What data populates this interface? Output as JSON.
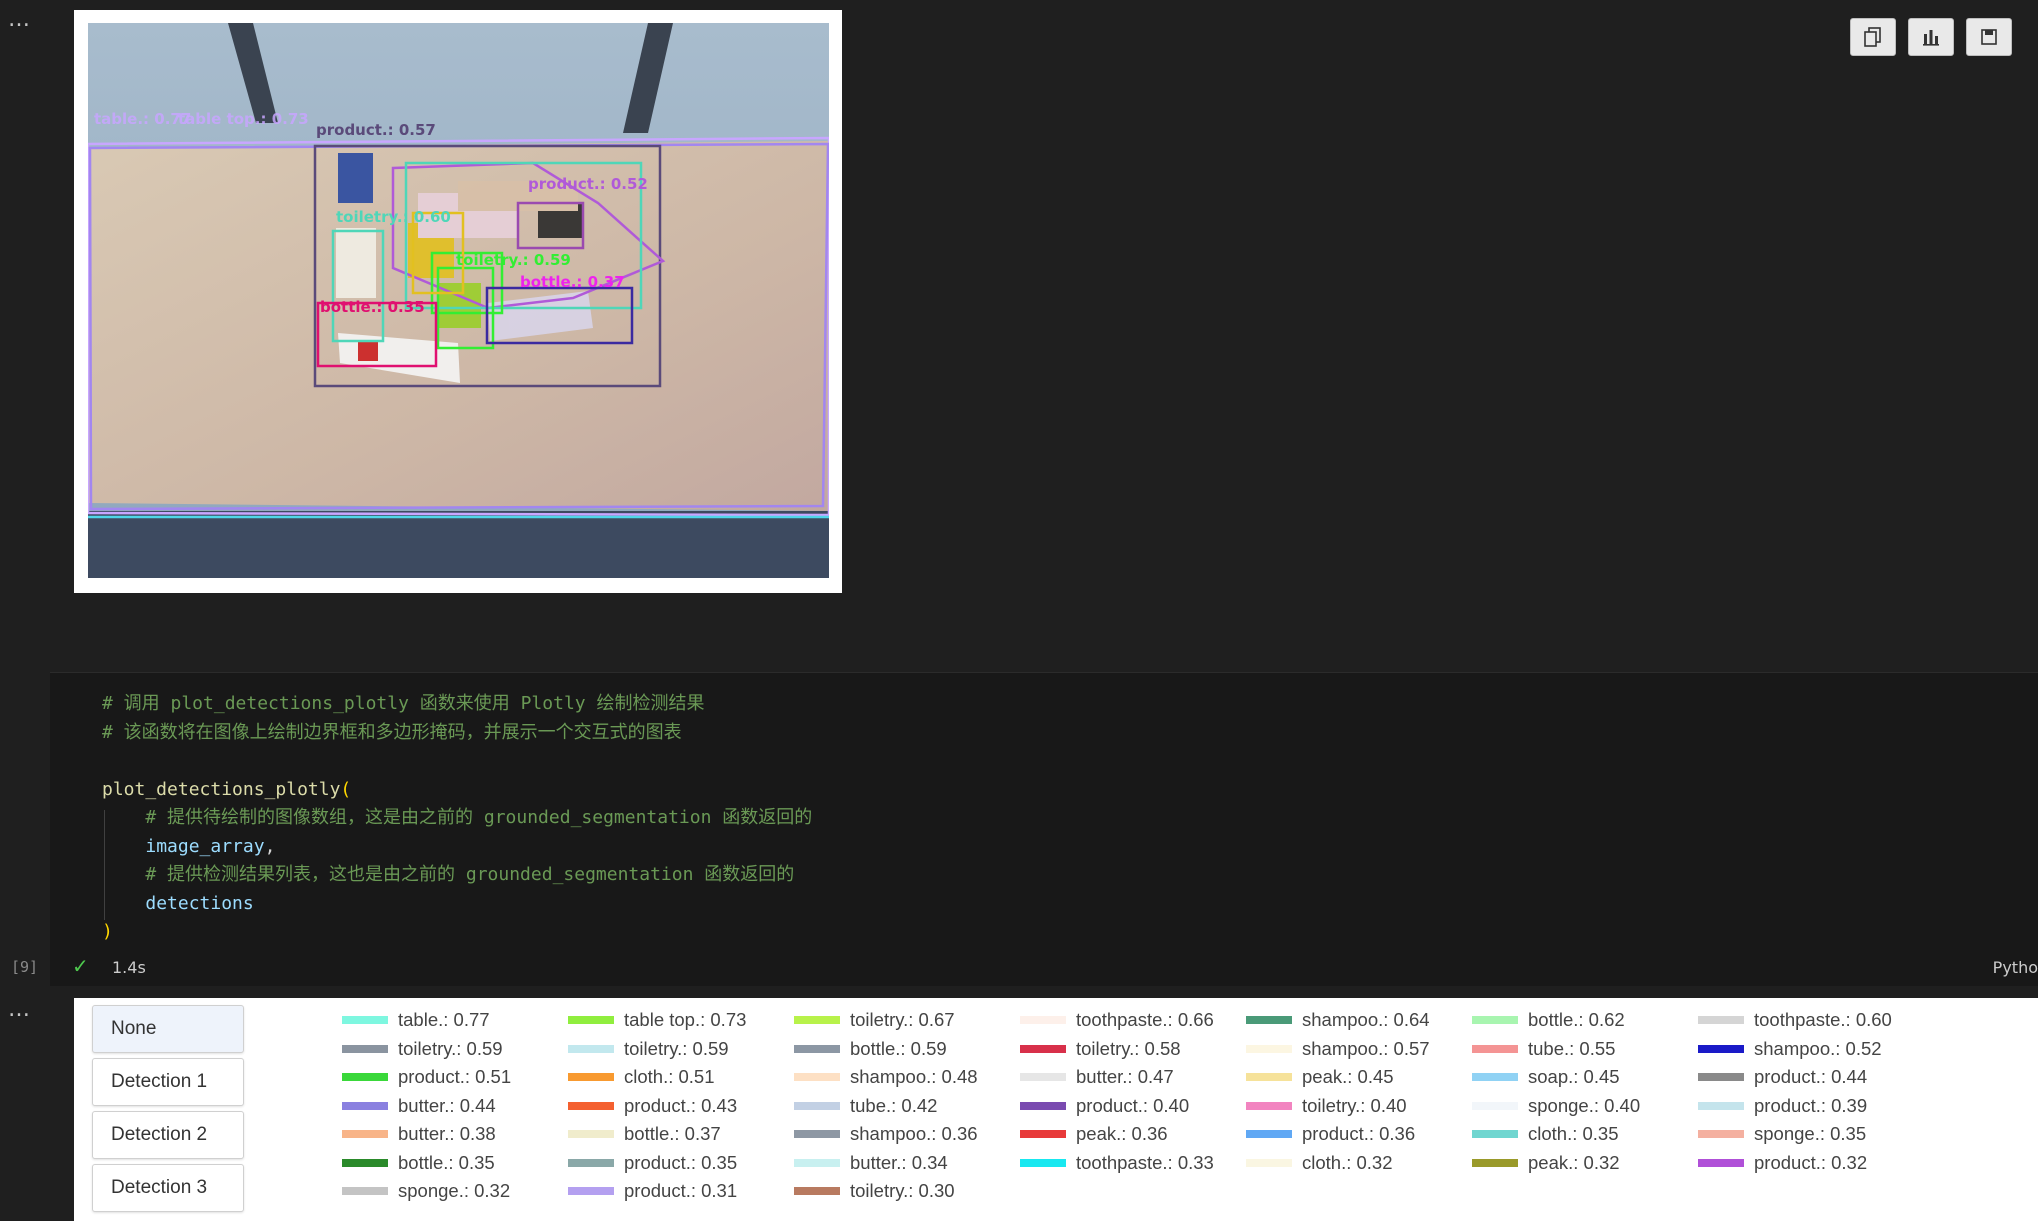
{
  "cell_menu_icon": "ellipsis",
  "toolbar_icons": [
    "copy-icon",
    "chart-icon",
    "save-icon"
  ],
  "detection_labels": [
    {
      "text": "table.: 0.77",
      "color": "#c8a6ff"
    },
    {
      "text": "table top.: 0.73",
      "color": "#c8a6ff"
    },
    {
      "text": "product.: 0.57",
      "color": "#5a4a7a"
    },
    {
      "text": "product.: 0.52",
      "color": "#b05ad8"
    },
    {
      "text": "toiletry.: 0.60",
      "color": "#4fd6b8"
    },
    {
      "text": "toiletry.: 0.59",
      "color": "#33ee33"
    },
    {
      "text": "bottle.: 0.37",
      "color": "#ee22ee"
    },
    {
      "text": "bottle.: 0.35",
      "color": "#e01070"
    }
  ],
  "code": {
    "comment1": "# 调用 plot_detections_plotly 函数来使用 Plotly 绘制检测结果",
    "comment2": "# 该函数将在图像上绘制边界框和多边形掩码，并展示一个交互式的图表",
    "fn_name": "plot_detections_plotly",
    "open_paren": "(",
    "comment3": "# 提供待绘制的图像数组，这是由之前的 grounded_segmentation 函数返回的",
    "arg1": "image_array",
    "comma": ",",
    "comment4": "# 提供检测结果列表，这也是由之前的 grounded_segmentation 函数返回的",
    "arg2": "detections",
    "close_paren": ")"
  },
  "exec": {
    "count": "[9]",
    "status_icon": "check-icon",
    "time": "1.4s",
    "language": "Pytho"
  },
  "detection_buttons": [
    "None",
    "Detection 1",
    "Detection 2",
    "Detection 3"
  ],
  "legend": [
    {
      "label": "table.: 0.77",
      "color": "#7ef7e0"
    },
    {
      "label": "table top.: 0.73",
      "color": "#90ee3e"
    },
    {
      "label": "toiletry.: 0.67",
      "color": "#b8f24a"
    },
    {
      "label": "toothpaste.: 0.66",
      "color": "#fdf0ea"
    },
    {
      "label": "shampoo.: 0.64",
      "color": "#4a9a78"
    },
    {
      "label": "bottle.: 0.62",
      "color": "#a8f5b0"
    },
    {
      "label": "toothpaste.: 0.60",
      "color": "#d5d5d5"
    },
    {
      "label": "toiletry.: 0.59",
      "color": "#8a94a0"
    },
    {
      "label": "toiletry.: 0.59",
      "color": "#c2e8ee"
    },
    {
      "label": "bottle.: 0.59",
      "color": "#8c97a4"
    },
    {
      "label": "toiletry.: 0.58",
      "color": "#d8304a"
    },
    {
      "label": "shampoo.: 0.57",
      "color": "#fcf6e2"
    },
    {
      "label": "tube.: 0.55",
      "color": "#f49494"
    },
    {
      "label": "shampoo.: 0.52",
      "color": "#1a1ac8"
    },
    {
      "label": "product.: 0.51",
      "color": "#3ad83a"
    },
    {
      "label": "cloth.: 0.51",
      "color": "#f89a30"
    },
    {
      "label": "shampoo.: 0.48",
      "color": "#fde0c4"
    },
    {
      "label": "butter.: 0.47",
      "color": "#e6e6e6"
    },
    {
      "label": "peak.: 0.45",
      "color": "#f6e29a"
    },
    {
      "label": "soap.: 0.45",
      "color": "#90d2f4"
    },
    {
      "label": "product.: 0.44",
      "color": "#8a8a8a"
    },
    {
      "label": "butter.: 0.44",
      "color": "#8a80e0"
    },
    {
      "label": "product.: 0.43",
      "color": "#f46030"
    },
    {
      "label": "tube.: 0.42",
      "color": "#c2d0e4"
    },
    {
      "label": "product.: 0.40",
      "color": "#7a4ab0"
    },
    {
      "label": "toiletry.: 0.40",
      "color": "#f284c0"
    },
    {
      "label": "sponge.: 0.40",
      "color": "#f2f6fa"
    },
    {
      "label": "product.: 0.39",
      "color": "#c4e4ec"
    },
    {
      "label": "butter.: 0.38",
      "color": "#f8b488"
    },
    {
      "label": "bottle.: 0.37",
      "color": "#f0eccc"
    },
    {
      "label": "shampoo.: 0.36",
      "color": "#8e98a4"
    },
    {
      "label": "peak.: 0.36",
      "color": "#e83a3a"
    },
    {
      "label": "product.: 0.36",
      "color": "#60a8f4"
    },
    {
      "label": "cloth.: 0.35",
      "color": "#70d6d0"
    },
    {
      "label": "sponge.: 0.35",
      "color": "#f4b0a0"
    },
    {
      "label": "bottle.: 0.35",
      "color": "#2a8a2a"
    },
    {
      "label": "product.: 0.35",
      "color": "#8aa8a8"
    },
    {
      "label": "butter.: 0.34",
      "color": "#c8f0f0"
    },
    {
      "label": "toothpaste.: 0.33",
      "color": "#18e8f0"
    },
    {
      "label": "cloth.: 0.32",
      "color": "#faf6e2"
    },
    {
      "label": "peak.: 0.32",
      "color": "#9a9a2a"
    },
    {
      "label": "product.: 0.32",
      "color": "#b050d8"
    },
    {
      "label": "sponge.: 0.32",
      "color": "#c4c4c4"
    },
    {
      "label": "product.: 0.31",
      "color": "#b4a0f0"
    },
    {
      "label": "toiletry.: 0.30",
      "color": "#b87a60"
    }
  ]
}
